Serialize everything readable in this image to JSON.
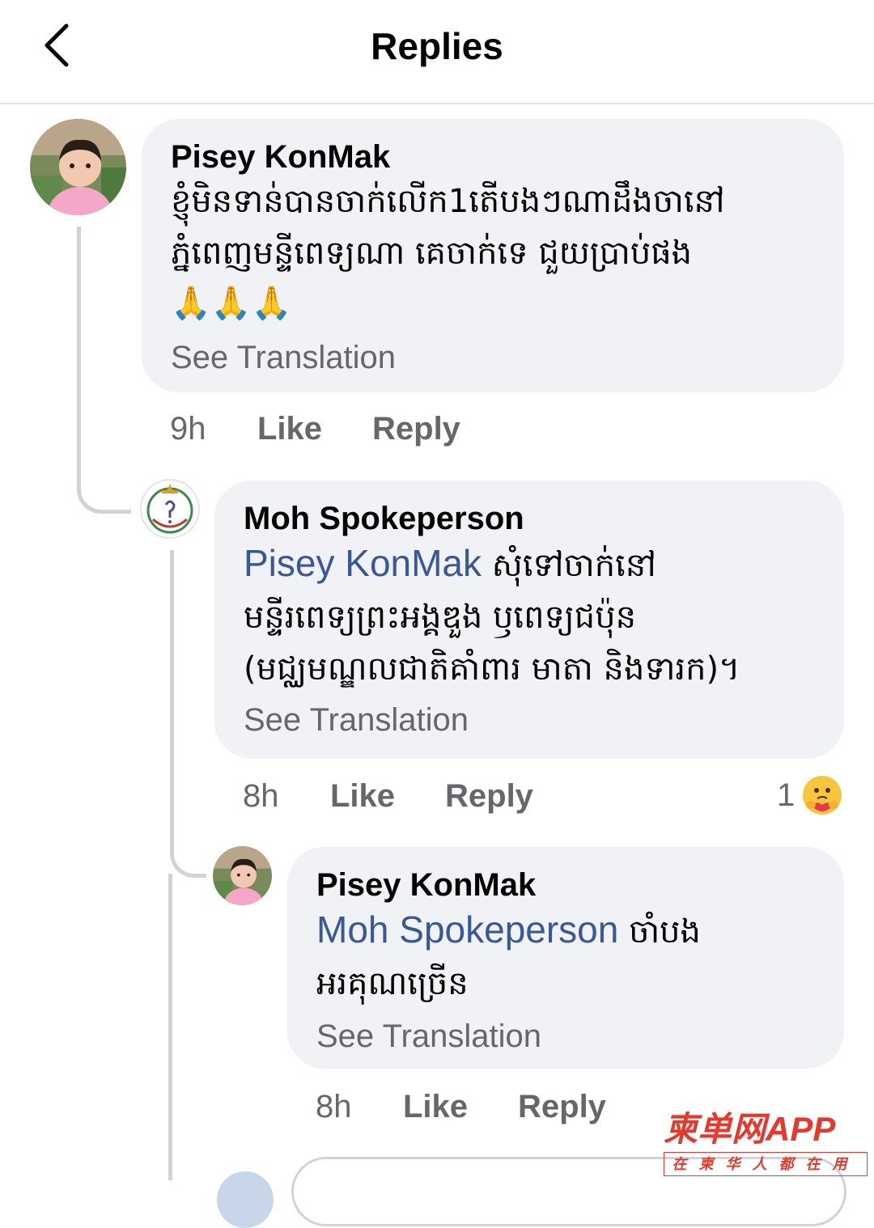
{
  "header": {
    "title": "Replies"
  },
  "comments": [
    {
      "author": "Pisey KonMak",
      "lines": [
        "ខ្ញុំមិនទាន់បានចាក់លើក1តើបងៗណាដឹងចានៅ",
        "ភ្នំពេញមន្ទីពេទ្យណា គេចាក់ទេ ជួយប្រាប់ផង",
        "🙏🙏🙏"
      ],
      "see_translation": "See Translation",
      "time": "9h",
      "like": "Like",
      "reply": "Reply"
    },
    {
      "author": "Moh Spokeperson",
      "mention": "Pisey KonMak",
      "lines": [
        "សុំទៅចាក់នៅ",
        "មន្ទីរពេទ្យព្រះអង្គឌួង ឫពេទ្យជប៉ុន",
        "(មជ្ឈមណ្ឌលជាតិគាំពារ មាតា និងទារក)។"
      ],
      "see_translation": "See Translation",
      "time": "8h",
      "like": "Like",
      "reply": "Reply",
      "reaction_count": "1",
      "reaction_icon": "care-emoji-icon"
    },
    {
      "author": "Pisey KonMak",
      "mention": "Moh Spokeperson",
      "lines": [
        "ចាំបង",
        "អរគុណច្រើន"
      ],
      "see_translation": "See Translation",
      "time": "8h",
      "like": "Like",
      "reply": "Reply"
    }
  ],
  "watermark": {
    "main": "柬单网APP",
    "sub": "在柬华人都在用"
  },
  "colors": {
    "bubble": "#f0f2f5",
    "mention": "#385898",
    "secondary_text": "#65676b",
    "watermark": "#e8382b"
  }
}
